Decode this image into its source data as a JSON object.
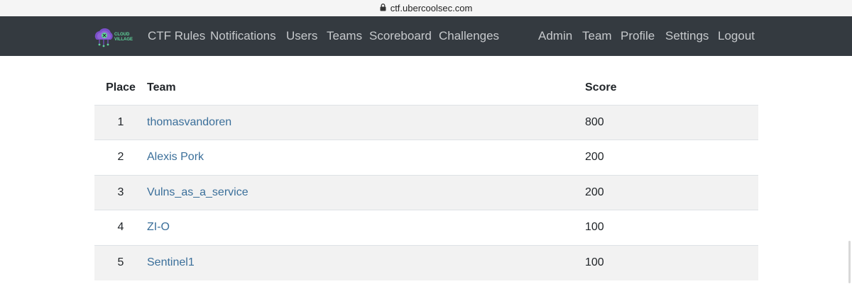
{
  "browser": {
    "url": "ctf.ubercoolsec.com"
  },
  "nav": {
    "logo_text_line1": "CLOUD",
    "logo_text_line2": "VILLAGE",
    "left": [
      "CTF Rules",
      "Notifications",
      "Users",
      "Teams",
      "Scoreboard",
      "Challenges"
    ],
    "right": [
      "Admin",
      "Team",
      "Profile",
      "Settings",
      "Logout"
    ]
  },
  "scoreboard": {
    "headers": {
      "place": "Place",
      "team": "Team",
      "score": "Score"
    },
    "rows": [
      {
        "place": "1",
        "team": "thomasvandoren",
        "score": "800"
      },
      {
        "place": "2",
        "team": "Alexis Pork",
        "score": "200"
      },
      {
        "place": "3",
        "team": "Vulns_as_a_service",
        "score": "200"
      },
      {
        "place": "4",
        "team": "ZI-O",
        "score": "100"
      },
      {
        "place": "5",
        "team": "Sentinel1",
        "score": "100"
      }
    ]
  },
  "colors": {
    "navbar": "#343a40",
    "link": "#3b6f9a",
    "stripe": "#f2f2f2",
    "logo_accent": "#5fd39a"
  }
}
